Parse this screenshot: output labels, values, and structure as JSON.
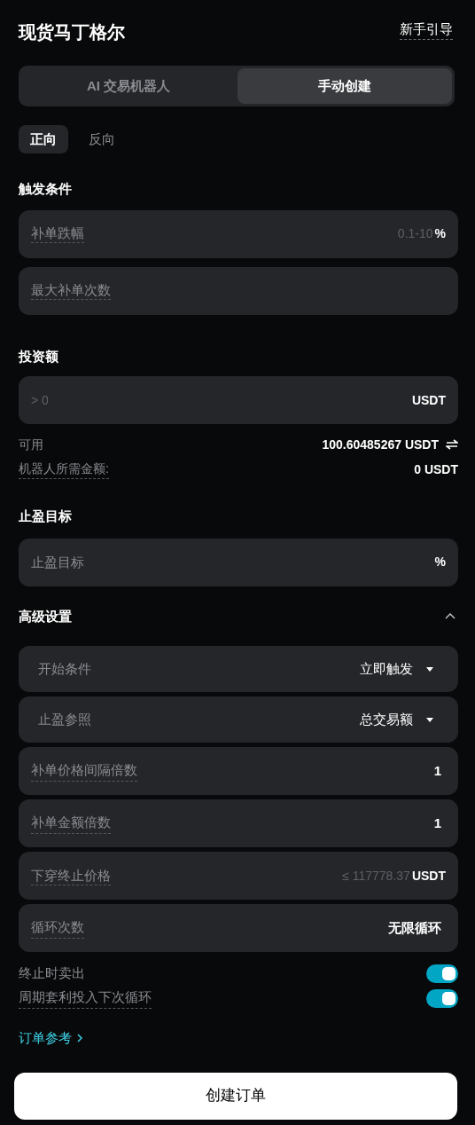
{
  "header": {
    "title": "现货马丁格尔",
    "guide_link": "新手引导"
  },
  "mode_tabs": [
    {
      "label": "AI 交易机器人",
      "selected": false
    },
    {
      "label": "手动创建",
      "selected": true
    }
  ],
  "direction_tabs": [
    {
      "label": "正向",
      "selected": true
    },
    {
      "label": "反向",
      "selected": false
    }
  ],
  "trigger": {
    "heading": "触发条件",
    "fields": [
      {
        "label": "补单跌幅",
        "has_tooltip": true,
        "placeholder": "0.1-10",
        "unit": "%"
      },
      {
        "label": "最大补单次数",
        "has_tooltip": true
      }
    ]
  },
  "investment": {
    "heading": "投资额",
    "field": {
      "placeholder": "> 0",
      "unit": "USDT"
    },
    "available": {
      "label": "可用",
      "value": "100.60485267 USDT"
    },
    "required": {
      "label": "机器人所需金额:",
      "has_tooltip": true,
      "value": "0 USDT"
    }
  },
  "take_profit": {
    "heading": "止盈目标",
    "field": {
      "label": "止盈目标",
      "has_tooltip": false,
      "unit": "%"
    }
  },
  "advanced": {
    "heading": "高级设置",
    "expanded": true,
    "rows": [
      {
        "kind": "select",
        "label": "开始条件",
        "value": "立即触发"
      },
      {
        "kind": "select",
        "label": "止盈参照",
        "value": "总交易额"
      },
      {
        "kind": "value",
        "label": "补单价格间隔倍数",
        "has_tooltip": true,
        "value": "1"
      },
      {
        "kind": "value",
        "label": "补单金额倍数",
        "has_tooltip": true,
        "value": "1"
      },
      {
        "kind": "input",
        "label": "下穿终止价格",
        "has_tooltip": true,
        "placeholder": "≤ 117778.37",
        "unit": "USDT"
      },
      {
        "kind": "value",
        "label": "循环次数",
        "has_tooltip": true,
        "value": "无限循环"
      }
    ]
  },
  "toggles": [
    {
      "label": "终止时卖出",
      "has_tooltip": false,
      "on": true
    },
    {
      "label": "周期套利投入下次循环",
      "has_tooltip": true,
      "on": true
    }
  ],
  "order_link": "订单参考",
  "submit": "创建订单"
}
